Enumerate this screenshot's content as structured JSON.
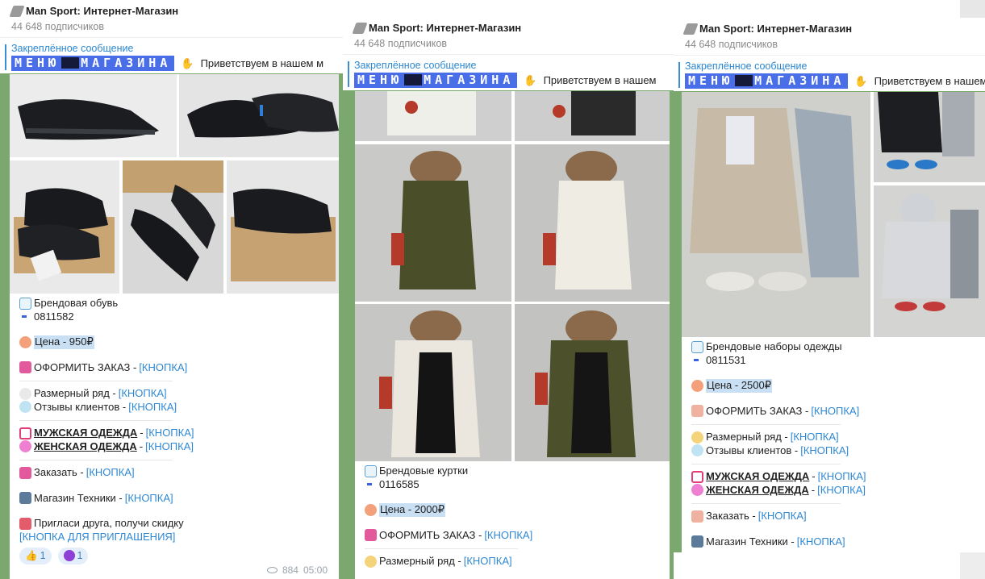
{
  "colors": {
    "accent_link": "#2f88d4",
    "menu_badge_bg": "#4a6de8",
    "chat_bg": "#7aa86f",
    "price_highlight": "#c9dff3"
  },
  "panels": [
    {
      "header": {
        "title": "Man Sport: Интернет-Магазин",
        "subscribers": "44 648 подписчиков"
      },
      "pinned": {
        "label": "Закреплённое сообщение",
        "menu_left": "МЕНЮ",
        "menu_right": "МАГАЗИНА",
        "preview": "Приветствуем в нашем м"
      },
      "post": {
        "category": "Брендовая обувь",
        "article": "0811582",
        "price": "Цена - 950₽",
        "order": "ОФОРМИТЬ ЗАКАЗ - ",
        "size_label": "Размерный ряд - ",
        "reviews_label": "Отзывы клиентов - ",
        "men": "МУЖСКАЯ ОДЕЖДА",
        "women": "ЖЕНСКАЯ ОДЕЖДА",
        "order2": "Заказать - ",
        "tech": "Магазин Техники - ",
        "invite": "Пригласи друга, получи скидку",
        "invite_button": "[КНОПКА ДЛЯ ПРИГЛАШЕНИЯ]",
        "button": "[КНОПКА]",
        "dash": " - ",
        "reactions": [
          {
            "emoji": "thumbs-up",
            "count": "1"
          },
          {
            "emoji": "devil",
            "count": "1"
          }
        ],
        "views": "884",
        "time": "05:00"
      }
    },
    {
      "header": {
        "title": "Man Sport: Интернет-Магазин",
        "subscribers": "44 648 подписчиков"
      },
      "pinned": {
        "label": "Закреплённое сообщение",
        "menu_left": "МЕНЮ",
        "menu_right": "МАГАЗИНА",
        "preview": "Приветствуем в нашем"
      },
      "post": {
        "category": "Брендовые куртки",
        "article": "0116585",
        "price": "Цена - 2000₽",
        "order": "ОФОРМИТЬ ЗАКАЗ - ",
        "size_label": "Размерный ряд - ",
        "button": "[КНОПКА]"
      }
    },
    {
      "header": {
        "title": "Man Sport: Интернет-Магазин",
        "subscribers": "44 648 подписчиков"
      },
      "pinned": {
        "label": "Закреплённое сообщение",
        "menu_left": "МЕНЮ",
        "menu_right": "МАГАЗИНА",
        "preview": "Приветствуем в нашем"
      },
      "post": {
        "category": "Брендовые наборы одежды",
        "article": "0811531",
        "price": "Цена - 2500₽",
        "order": "ОФОРМИТЬ ЗАКАЗ - ",
        "size_label": "Размерный ряд - ",
        "reviews_label": "Отзывы клиентов - ",
        "men": "МУЖСКАЯ ОДЕЖДА",
        "women": "ЖЕНСКАЯ ОДЕЖДА",
        "order2": "Заказать - ",
        "tech": "Магазин Техники - ",
        "button": "[КНОПКА]",
        "dash": " - "
      }
    }
  ]
}
